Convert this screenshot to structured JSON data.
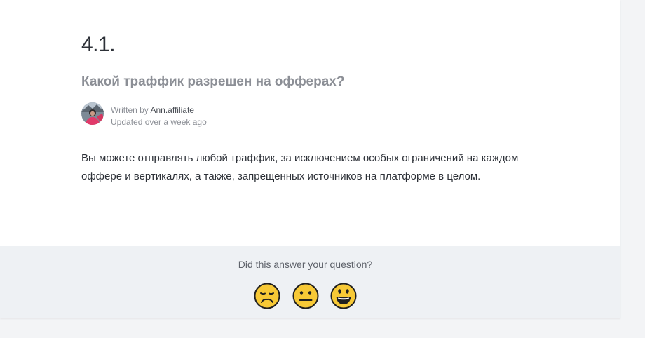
{
  "article": {
    "number": "4.1.",
    "question": "Какой траффик разрешен на офферах?",
    "author": {
      "written_by_label": "Written by",
      "name": "Ann.affiliate",
      "updated": "Updated over a week ago"
    },
    "body": "Вы можете отправлять любой траффик, за исключением особых ограничений на каждом оффере и вертикалях, а также, запрещенных источников на платформе в целом."
  },
  "feedback": {
    "question": "Did this answer your question?",
    "reactions": [
      {
        "icon": "disappointed-face-icon"
      },
      {
        "icon": "neutral-face-icon"
      },
      {
        "icon": "smiley-face-icon"
      }
    ]
  },
  "colors": {
    "background": "#f3f4f6",
    "card": "#ffffff",
    "feedback_bg": "#eef1f4",
    "emoji_yellow": "#f7c936"
  }
}
